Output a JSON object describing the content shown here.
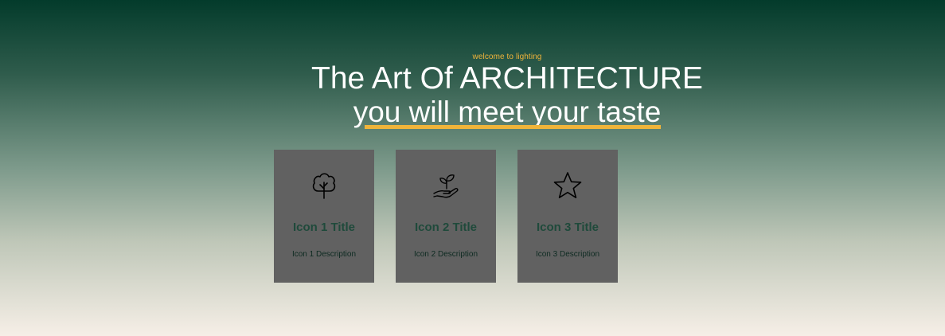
{
  "hero": {
    "eyebrow": "welcome to lighting",
    "headline": "The Art Of ARCHITECTURE",
    "subline": "you will meet your taste"
  },
  "cards": [
    {
      "icon": "tree-icon",
      "title": "Icon 1 Title",
      "description": "Icon 1 Description"
    },
    {
      "icon": "plant-in-hand-icon",
      "title": "Icon 2 Title",
      "description": "Icon 2 Description"
    },
    {
      "icon": "star-icon",
      "title": "Icon 3 Title",
      "description": "Icon 3 Description"
    }
  ],
  "colors": {
    "accent": "#f0b43a",
    "card_bg": "#616161",
    "card_title": "#1f4a3b",
    "gradient_top": "#033b2b",
    "gradient_bottom": "#f6efe7"
  }
}
